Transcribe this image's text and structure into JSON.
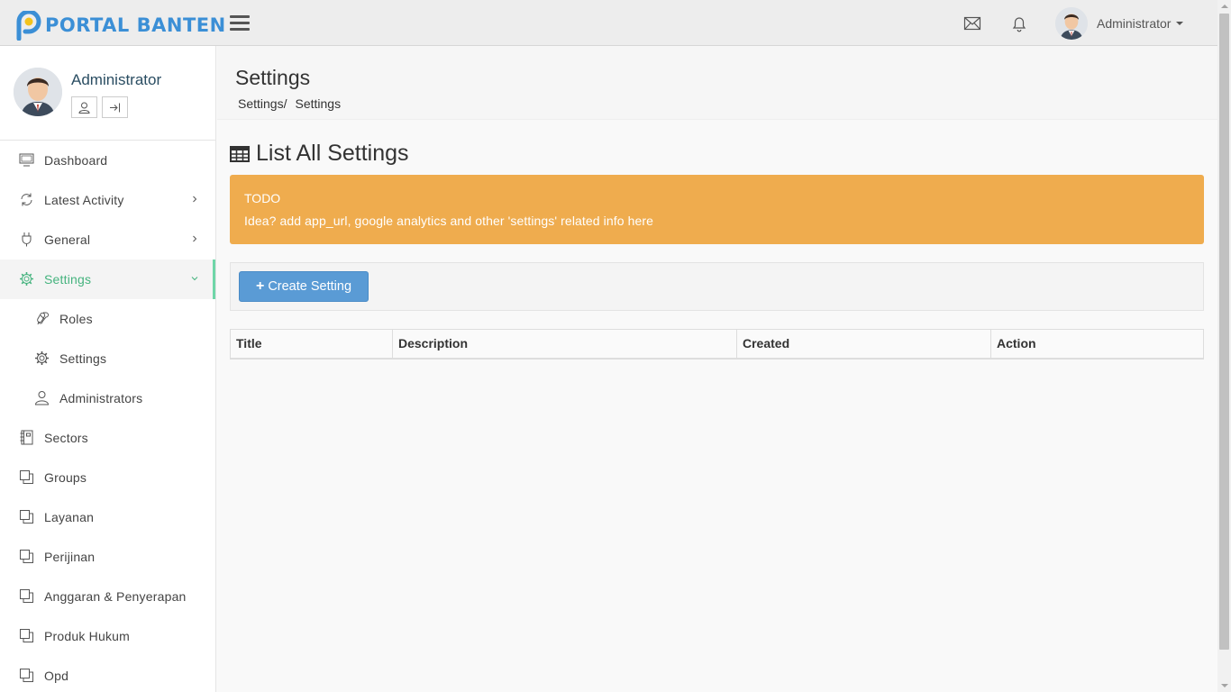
{
  "brand": {
    "name": "PORTAL BANTEN",
    "color": "#3b8fd6"
  },
  "topbar": {
    "menu_icon": "hamburger-icon",
    "mail_icon": "envelope-icon",
    "notification_icon": "bell-icon",
    "user_name": "Administrator"
  },
  "profile": {
    "name": "Administrator",
    "profile_icon": "user-icon",
    "logout_icon": "logout-icon"
  },
  "sidebar": {
    "items": [
      {
        "label": "Dashboard",
        "icon": "monitor-icon"
      },
      {
        "label": "Latest Activity",
        "icon": "refresh-icon",
        "has_children": true
      },
      {
        "label": "General",
        "icon": "plug-icon",
        "has_children": true
      },
      {
        "label": "Settings",
        "icon": "gear-icon",
        "expanded": true,
        "active": true
      },
      {
        "label": "Roles",
        "icon": "link-icon",
        "sub": true
      },
      {
        "label": "Settings",
        "icon": "gear-icon",
        "sub": true
      },
      {
        "label": "Administrators",
        "icon": "user-icon",
        "sub": true
      },
      {
        "label": "Sectors",
        "icon": "notebook-icon"
      },
      {
        "label": "Groups",
        "icon": "windows-icon"
      },
      {
        "label": "Layanan",
        "icon": "windows-icon"
      },
      {
        "label": "Perijinan",
        "icon": "windows-icon"
      },
      {
        "label": "Anggaran & Penyerapan",
        "icon": "windows-icon"
      },
      {
        "label": "Produk Hukum",
        "icon": "windows-icon"
      },
      {
        "label": "Opd",
        "icon": "windows-icon"
      }
    ],
    "active_color": "#45b37e"
  },
  "page": {
    "title": "Settings",
    "breadcrumb": [
      "Settings/",
      "Settings"
    ],
    "list_heading": "List All Settings",
    "alert": {
      "title": "TODO",
      "text": "Idea? add app_url, google analytics and other 'settings' related info here",
      "color": "#efac4e"
    },
    "create_button": "Create Setting",
    "table_columns": [
      "Title",
      "Description",
      "Created",
      "Action"
    ]
  }
}
